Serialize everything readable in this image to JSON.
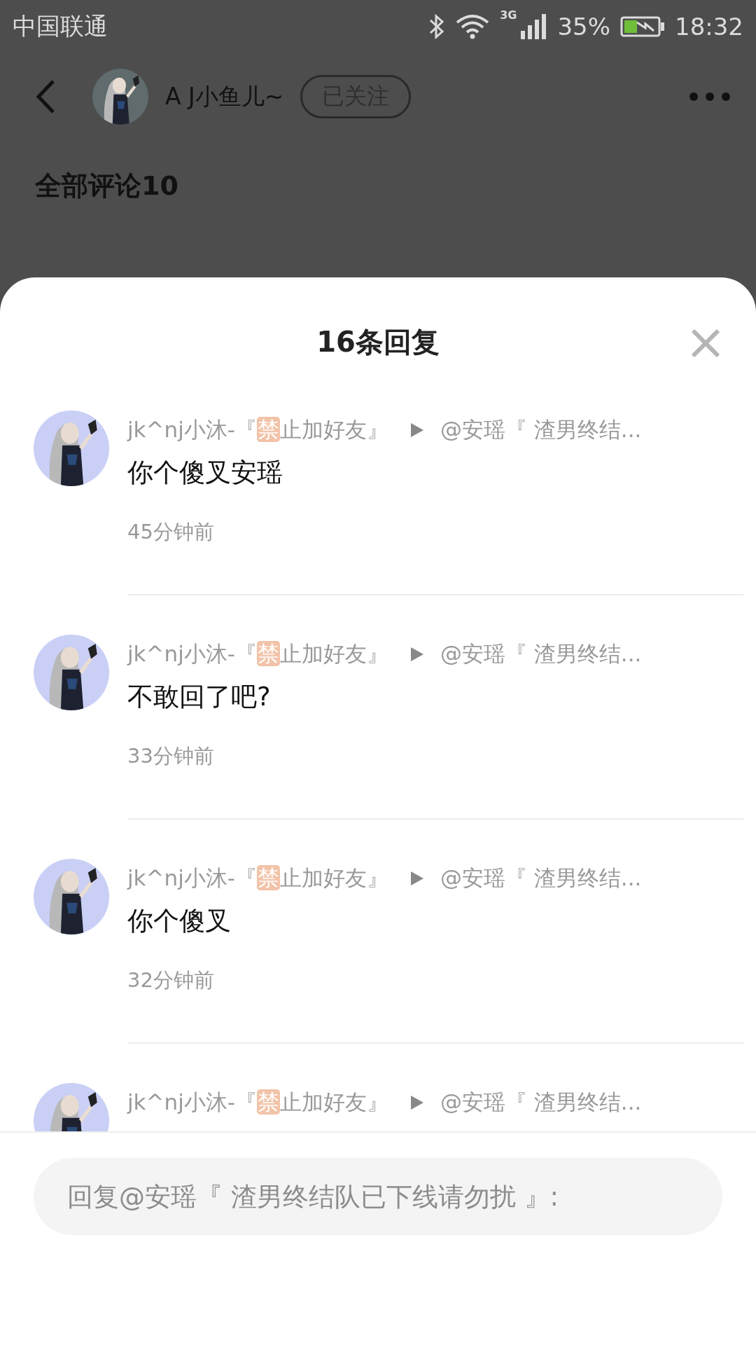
{
  "status_bar": {
    "carrier": "中国联通",
    "network": "3G",
    "battery": "35%",
    "time": "18:32"
  },
  "header": {
    "author": "A J小鱼儿~",
    "follow": {
      "label": "已关注",
      "followed": true
    }
  },
  "comments_heading": "全部评论10",
  "sheet": {
    "title": "16条回复",
    "replies": [
      {
        "name_prefix": "jk^nj小沐-『",
        "badge": "禁",
        "name_suffix": "止加好友』",
        "target": "@安瑶『 渣男终结...",
        "content": "你个傻叉安瑶",
        "time": "45分钟前"
      },
      {
        "name_prefix": "jk^nj小沐-『",
        "badge": "禁",
        "name_suffix": "止加好友』",
        "target": "@安瑶『 渣男终结...",
        "content": "不敢回了吧?",
        "time": "33分钟前"
      },
      {
        "name_prefix": "jk^nj小沐-『",
        "badge": "禁",
        "name_suffix": "止加好友』",
        "target": "@安瑶『 渣男终结...",
        "content": "你个傻叉",
        "time": "32分钟前"
      },
      {
        "name_prefix": "jk^nj小沐-『",
        "badge": "禁",
        "name_suffix": "止加好友』",
        "target": "@安瑶『 渣男终结..."
      }
    ],
    "reply_input": {
      "placeholder": "回复@安瑶『 渣男终结队已下线请勿扰 』:"
    }
  }
}
